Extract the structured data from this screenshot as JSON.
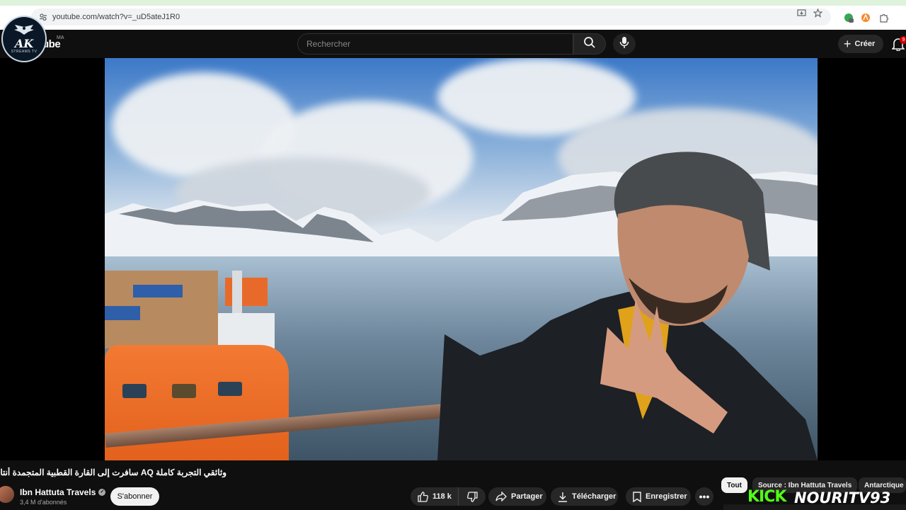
{
  "browser": {
    "url": "youtube.com/watch?v=_uD5ateJ1R0"
  },
  "overlay_logo": {
    "main": "AK",
    "sub": "STREAMS TV"
  },
  "header": {
    "brand": "ube",
    "region": "MA",
    "search_placeholder": "Rechercher",
    "create_label": "Créer",
    "notification_count": "9"
  },
  "video": {
    "title": "وثائقي التجربة كاملة AQ سافرت إلى القارة القطبية المتجمدة أنتاركتيكا"
  },
  "channel": {
    "name": "Ibn Hattuta Travels",
    "subscribers": "3,4 M d'abonnés",
    "subscribe_label": "S'abonner"
  },
  "actions": {
    "likes": "118 k",
    "share_label": "Partager",
    "download_label": "Télécharger",
    "save_label": "Enregistrer"
  },
  "chips": [
    {
      "label": "Tout",
      "active": true
    },
    {
      "label": "Source : Ibn Hattuta Travels",
      "active": false
    },
    {
      "label": "Antarctique",
      "active": false
    }
  ],
  "watermark": {
    "kick": "KICK",
    "handle": "NOURITV93"
  },
  "colors": {
    "background": "#0f0f0f",
    "kick_green": "#53fc18",
    "button_gray": "#272727"
  }
}
